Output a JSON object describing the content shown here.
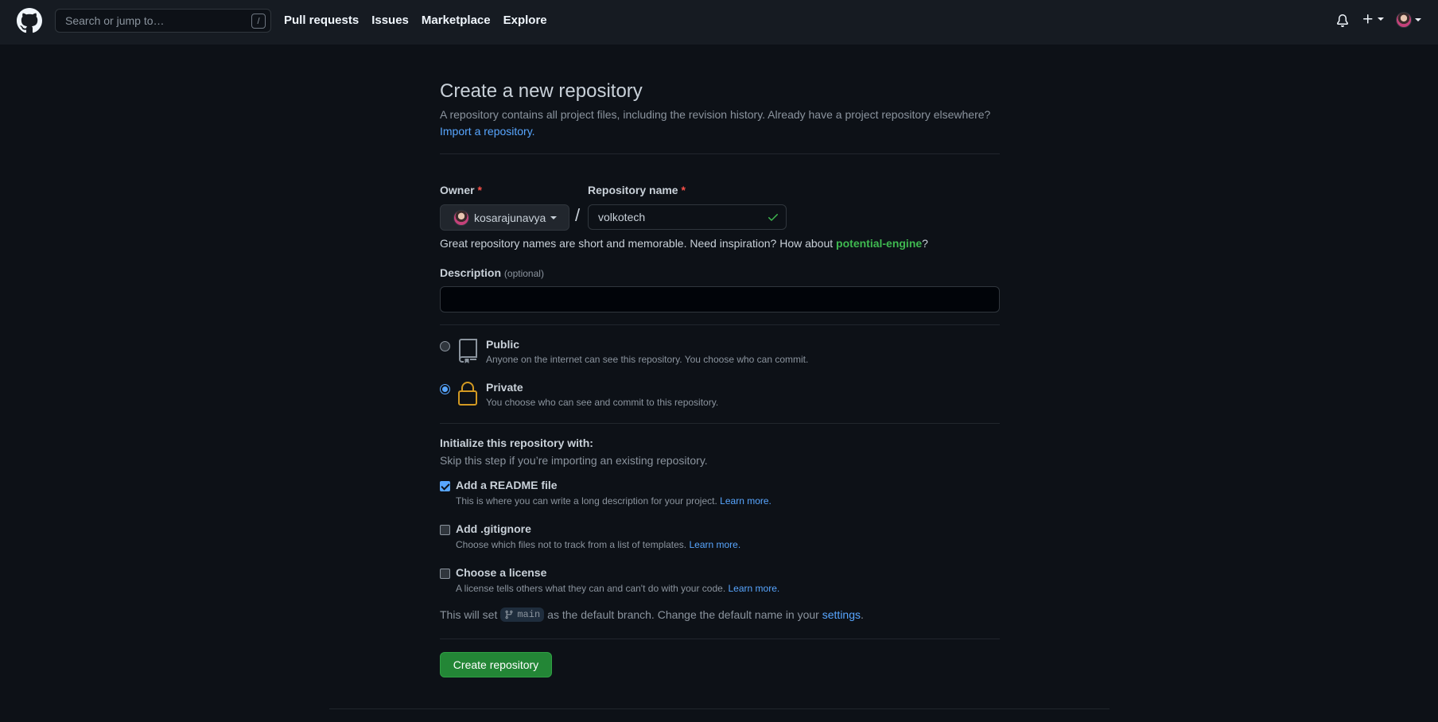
{
  "header": {
    "search_placeholder": "Search or jump to…",
    "search_shortcut": "/",
    "nav": [
      "Pull requests",
      "Issues",
      "Marketplace",
      "Explore"
    ]
  },
  "page": {
    "title": "Create a new repository",
    "subtitle": "A repository contains all project files, including the revision history. Already have a project repository elsewhere?",
    "import_link": "Import a repository."
  },
  "form": {
    "owner_label": "Owner",
    "owner_value": "kosarajunavya",
    "required_mark": "*",
    "slash": "/",
    "repo_label": "Repository name",
    "repo_value": "volkotech",
    "hint_prefix": "Great repository names are short and memorable. Need inspiration? How about ",
    "hint_suggestion": "potential-engine",
    "hint_suffix": "?",
    "description_label": "Description",
    "description_optional": "(optional)",
    "description_value": ""
  },
  "visibility": {
    "options": [
      {
        "title": "Public",
        "desc": "Anyone on the internet can see this repository. You choose who can commit.",
        "icon": "repo-icon",
        "checked": false
      },
      {
        "title": "Private",
        "desc": "You choose who can see and commit to this repository.",
        "icon": "lock-icon",
        "checked": true
      }
    ]
  },
  "init": {
    "title": "Initialize this repository with:",
    "subtitle": "Skip this step if you’re importing an existing repository.",
    "options": [
      {
        "title": "Add a README file",
        "desc": "This is where you can write a long description for your project.",
        "link": "Learn more.",
        "checked": true
      },
      {
        "title": "Add .gitignore",
        "desc": "Choose which files not to track from a list of templates.",
        "link": "Learn more.",
        "checked": false
      },
      {
        "title": "Choose a license",
        "desc": "A license tells others what they can and can't do with your code.",
        "link": "Learn more.",
        "checked": false
      }
    ]
  },
  "branch": {
    "prefix": "This will set",
    "name": "main",
    "middle": "as the default branch. Change the default name in your",
    "settings_link": "settings",
    "suffix": "."
  },
  "submit_label": "Create repository",
  "colors": {
    "background": "#0d1117",
    "header": "#161b22",
    "link": "#58a6ff",
    "success": "#238636",
    "lock": "#d29922"
  }
}
